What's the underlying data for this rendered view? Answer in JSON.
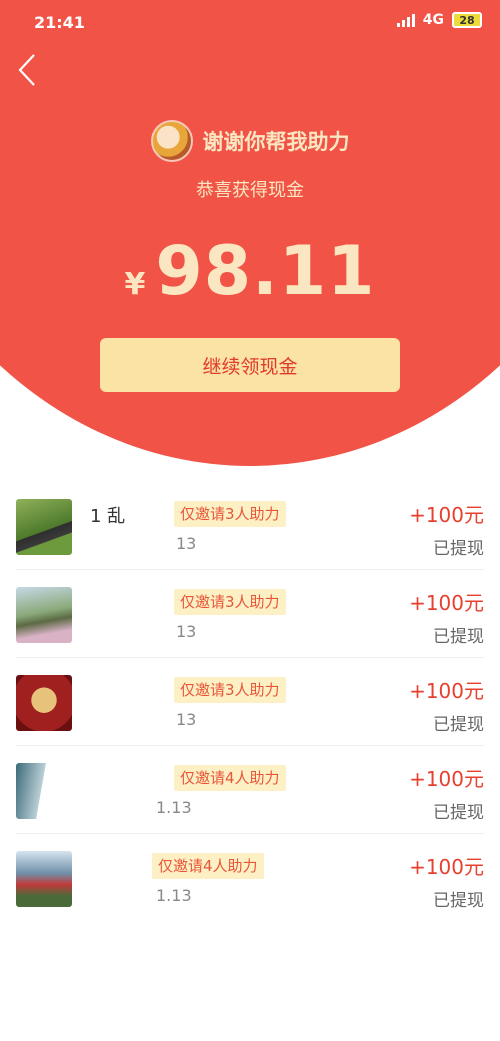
{
  "status_bar": {
    "time": "21:41",
    "network": "4G",
    "battery": "28"
  },
  "header": {
    "back_icon": "chevron-left-icon",
    "title": "谢谢你帮我助力",
    "subtitle": "恭喜获得现金",
    "currency": "¥",
    "amount": "98.11",
    "cta_label": "继续领现金"
  },
  "colors": {
    "hero_red": "#f15446",
    "cream": "#fbe6c2",
    "button_bg": "#fae3a4",
    "accent_red": "#e8402f",
    "badge_bg": "#fdf0c4"
  },
  "records": [
    {
      "name": "1 乱",
      "badge": "仅邀请3人助力",
      "date": "13",
      "amount": "+100元",
      "status": "已提现"
    },
    {
      "name": "",
      "badge": "仅邀请3人助力",
      "date": "13",
      "amount": "+100元",
      "status": "已提现"
    },
    {
      "name": "",
      "badge": "仅邀请3人助力",
      "date": "13",
      "amount": "+100元",
      "status": "已提现"
    },
    {
      "name": "",
      "badge": "仅邀请4人助力",
      "date": "1.13",
      "amount": "+100元",
      "status": "已提现"
    },
    {
      "name": "",
      "badge": "仅邀请4人助力",
      "date": "1.13",
      "amount": "+100元",
      "status": "已提现"
    }
  ]
}
